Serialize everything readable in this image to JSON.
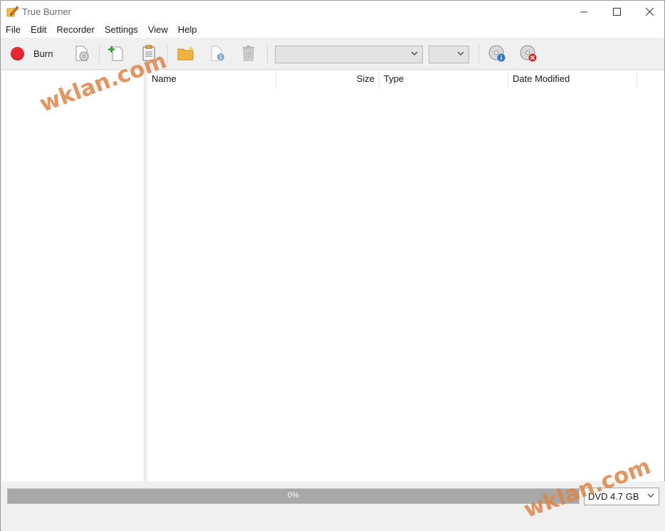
{
  "window": {
    "title": "True Burner",
    "controls": {
      "minimize": "—",
      "maximize": "☐",
      "close": "✕"
    }
  },
  "menu": [
    "File",
    "Edit",
    "Recorder",
    "Settings",
    "View",
    "Help"
  ],
  "toolbar": {
    "burn_label": "Burn",
    "burn_color": "#e8262f",
    "icons": [
      "disc-doc-icon",
      "add-file-icon",
      "clipboard-icon",
      "new-folder-icon",
      "file-info-icon",
      "trash-icon",
      "disc-info-icon",
      "disc-erase-icon"
    ],
    "recorder_select": "",
    "speed_select": ""
  },
  "file_list": {
    "columns": [
      "Name",
      "Size",
      "Type",
      "Date Modified"
    ],
    "rows": []
  },
  "status": {
    "progress_text": "0%",
    "progress_fraction": 0,
    "disc_type": "DVD 4.7 GB"
  },
  "watermarks": [
    "wklan.com",
    "wklan.com"
  ]
}
